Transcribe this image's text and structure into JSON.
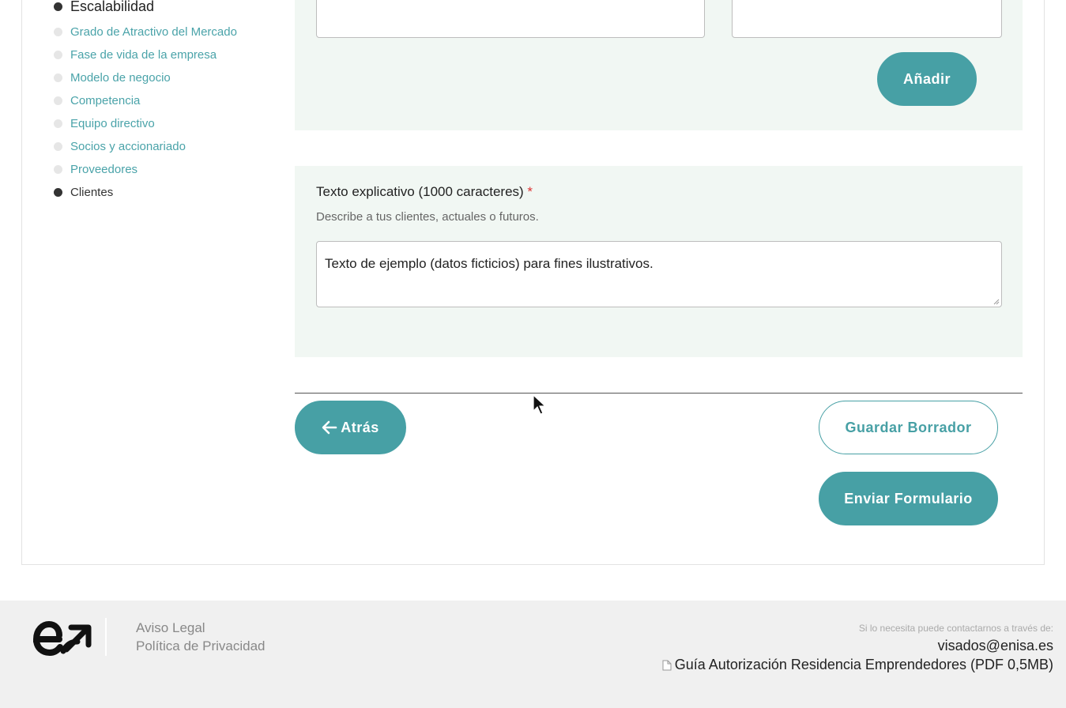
{
  "sidebar": {
    "items": [
      {
        "label": "Escalabilidad",
        "state": "done"
      },
      {
        "label": "Grado de Atractivo del Mercado",
        "state": "pending"
      },
      {
        "label": "Fase de vida de la empresa",
        "state": "pending"
      },
      {
        "label": "Modelo de negocio",
        "state": "pending"
      },
      {
        "label": "Competencia",
        "state": "pending"
      },
      {
        "label": "Equipo directivo",
        "state": "pending"
      },
      {
        "label": "Socios y accionariado",
        "state": "pending"
      },
      {
        "label": "Proveedores",
        "state": "pending"
      },
      {
        "label": "Clientes",
        "state": "current"
      }
    ]
  },
  "form": {
    "add_button": "Añadir",
    "clients_label": "Texto explicativo (1000 caracteres)",
    "required_mark": "*",
    "clients_help": "Describe a tus clientes, actuales o futuros.",
    "clients_value": "Texto de ejemplo (datos ficticios) para fines ilustrativos."
  },
  "nav": {
    "back_label": "Atrás",
    "save_draft_label": "Guardar Borrador",
    "submit_label": "Enviar Formulario"
  },
  "footer": {
    "logo_icon": "enisa-logo",
    "legal_link": "Aviso Legal",
    "privacy_link": "Política de Privacidad",
    "contact_note": "Si lo necesita puede contactarnos a través de:",
    "contact_email": "visados@enisa.es",
    "guide_icon": "document-icon",
    "guide_link": "Guía Autorización Residencia Emprendedores (PDF 0,5MB)"
  },
  "colors": {
    "accent": "#47a0a5",
    "section_bg": "#f1f7f3",
    "footer_bg": "#f0f0f0"
  }
}
